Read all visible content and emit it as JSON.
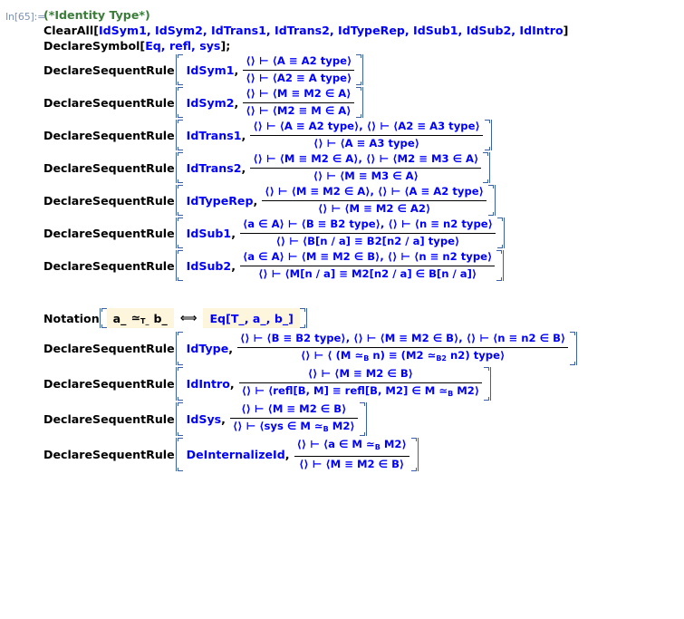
{
  "notebook": {
    "in_label": "In[65]:=",
    "comment": "(*Identity Type*)",
    "clear_all": {
      "head": "ClearAll",
      "open": "[",
      "args": "IdSym1, IdSym2, IdTrans1, IdTrans2, IdTypeRep, IdSub1, IdSub2, IdIntro",
      "close": "]"
    },
    "declare_symbol": {
      "head": "DeclareSymbol",
      "open": "[",
      "args": "Eq, refl, sys",
      "close": "];"
    },
    "rule_head": "DeclareSequentRule",
    "rules": [
      {
        "name": "IdSym1",
        "numerator": "⟨⟩ ⊢ ⟨A ≡ A2 type⟩",
        "denominator": "⟨⟩ ⊢ ⟨A2 ≡ A type⟩"
      },
      {
        "name": "IdSym2",
        "numerator": "⟨⟩ ⊢ ⟨M ≡ M2 ∈ A⟩",
        "denominator": "⟨⟩ ⊢ ⟨M2 ≡ M ∈ A⟩"
      },
      {
        "name": "IdTrans1",
        "numerator": "⟨⟩ ⊢ ⟨A ≡ A2 type⟩, ⟨⟩ ⊢ ⟨A2 ≡ A3 type⟩",
        "denominator": "⟨⟩ ⊢ ⟨A ≡ A3 type⟩"
      },
      {
        "name": "IdTrans2",
        "numerator": "⟨⟩ ⊢ ⟨M ≡ M2 ∈ A⟩, ⟨⟩ ⊢ ⟨M2 ≡ M3 ∈ A⟩",
        "denominator": "⟨⟩ ⊢ ⟨M ≡ M3 ∈ A⟩"
      },
      {
        "name": "IdTypeRep",
        "numerator": "⟨⟩ ⊢ ⟨M ≡ M2 ∈ A⟩, ⟨⟩ ⊢ ⟨A ≡ A2 type⟩",
        "denominator": "⟨⟩ ⊢ ⟨M ≡ M2 ∈ A2⟩"
      },
      {
        "name": "IdSub1",
        "numerator": "⟨a ∈ A⟩ ⊢ ⟨B ≡ B2 type⟩, ⟨⟩ ⊢ ⟨n ≡ n2 type⟩",
        "denominator": "⟨⟩ ⊢ ⟨B[n / a] ≡ B2[n2 / a] type⟩"
      },
      {
        "name": "IdSub2",
        "numerator": "⟨a ∈ A⟩ ⊢ ⟨M ≡ M2 ∈ B⟩, ⟨⟩ ⊢ ⟨n ≡ n2 type⟩",
        "denominator": "⟨⟩ ⊢ ⟨M[n / a] ≡ M2[n2 / a] ∈ B[n / a]⟩"
      }
    ],
    "notation": {
      "head": "Notation",
      "lhs_a": "a_",
      "lhs_op": "≃",
      "lhs_op_sub": "T_",
      "lhs_b": "b_",
      "equiv": "⟺",
      "rhs": "Eq[T_, a_, b_]"
    },
    "rules2": [
      {
        "name": "IdType",
        "numerator": "⟨⟩ ⊢ ⟨B ≡ B2 type⟩, ⟨⟩ ⊢ ⟨M ≡ M2 ∈ B⟩, ⟨⟩ ⊢ ⟨n ≡ n2 ∈ B⟩",
        "denominator_pre": "⟨⟩ ⊢ ⟨ (M ≃",
        "denominator_sub1": "B",
        "denominator_mid": " n) ≡ (M2 ≃",
        "denominator_sub2": "B2",
        "denominator_post": " n2) type⟩"
      },
      {
        "name": "IdIntro",
        "numerator": "⟨⟩ ⊢ ⟨M ≡ M2 ∈ B⟩",
        "denominator_pre": "⟨⟩ ⊢ ⟨refl[B, M] ≡ refl[B, M2] ∈ M ≃",
        "denominator_sub1": "B",
        "denominator_post": " M2⟩"
      },
      {
        "name": "IdSys",
        "numerator": "⟨⟩ ⊢ ⟨M ≡ M2 ∈ B⟩",
        "denominator_pre": "⟨⟩ ⊢ ⟨sys ∈ M ≃",
        "denominator_sub1": "B",
        "denominator_post": " M2⟩"
      },
      {
        "name": "DeInternalizeId",
        "numerator_pre": "⟨⟩ ⊢ ⟨a ∈ M ≃",
        "numerator_sub1": "B",
        "numerator_post": " M2⟩",
        "denominator": "⟨⟩ ⊢ ⟨M ≡ M2 ∈ B⟩"
      }
    ],
    "colors": {
      "symbol_blue": "#0000ff",
      "comment_green": "#3a7d3a",
      "bracket_blue": "#3b5fa8",
      "in_label_gray": "#7d93b2",
      "highlight_yellow": "#fdf6dc"
    }
  }
}
